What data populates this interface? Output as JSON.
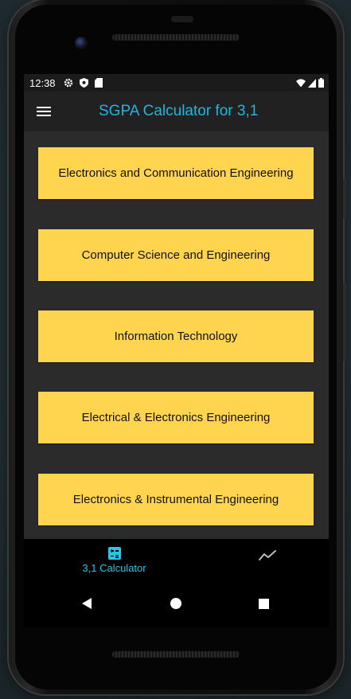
{
  "status_bar": {
    "time": "12:38"
  },
  "app_bar": {
    "title": "SGPA Calculator for 3,1"
  },
  "branches": [
    {
      "label": "Electronics and Communication Engineering"
    },
    {
      "label": "Computer Science and Engineering"
    },
    {
      "label": "Information Technology"
    },
    {
      "label": "Electrical & Electronics Engineering"
    },
    {
      "label": "Electronics & Instrumental Engineering"
    }
  ],
  "bottom_nav": {
    "items": [
      {
        "label": "3,1 Calculator",
        "icon": "calculator-icon",
        "active": true
      },
      {
        "label": "",
        "icon": "trending-line-icon",
        "active": false
      }
    ]
  },
  "colors": {
    "accent": "#1fb5e0",
    "button": "#ffd54f",
    "content_bg": "#2b2b2b",
    "app_bar_bg": "#212121"
  }
}
